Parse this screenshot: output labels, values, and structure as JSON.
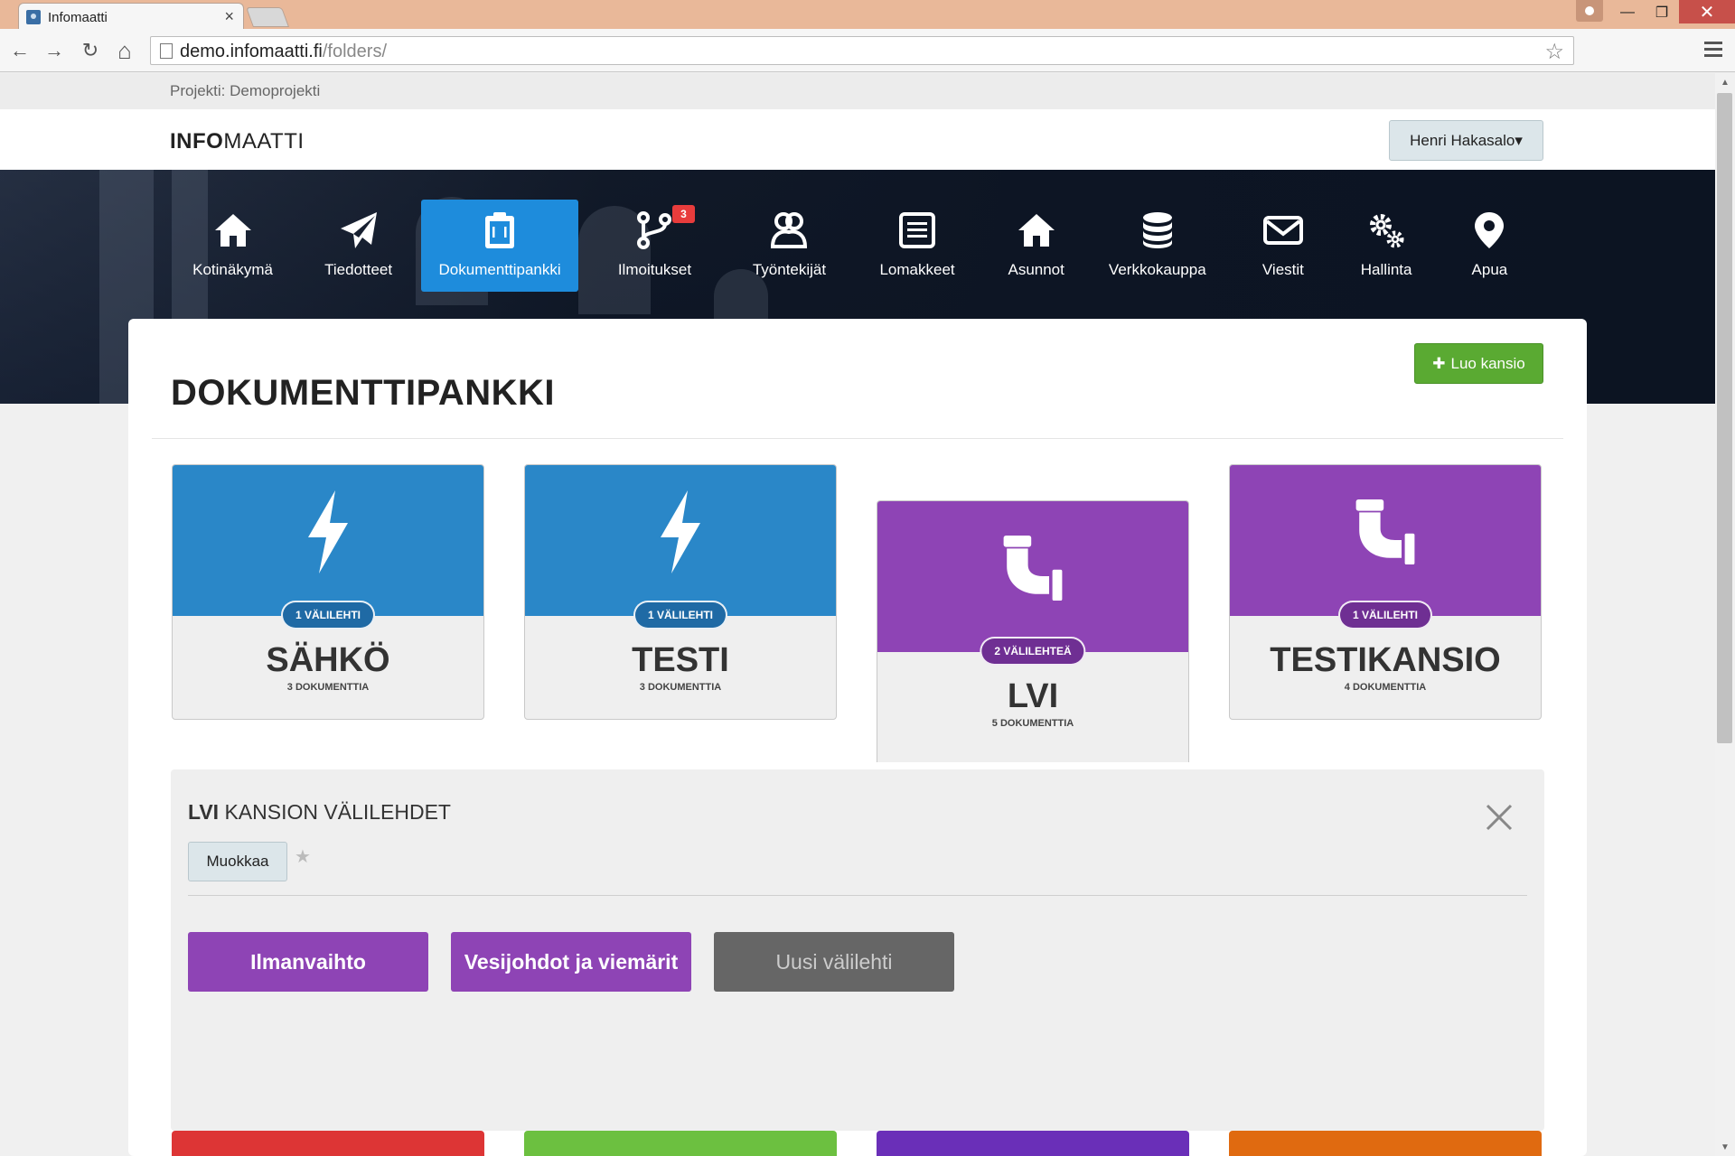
{
  "browser": {
    "tab_title": "Infomaatti",
    "tab_close": "×",
    "url_host": "demo.infomaatti.fi",
    "url_path": "/folders/",
    "back": "←",
    "forward": "→",
    "reload": "↻",
    "home": "⌂",
    "bookmark_star": "☆",
    "window_minimize": "—",
    "window_maximize": "❐",
    "window_close": "✕"
  },
  "scrollbar": {
    "up": "▲",
    "down": "▼"
  },
  "project_bar": {
    "label": "Projekti: Demoprojekti"
  },
  "header": {
    "logo_bold": "INFO",
    "logo_rest": "MAATTI",
    "user_menu": "Henri Hakasalo▾"
  },
  "navbar": {
    "items": [
      {
        "label": "Kotinäkymä",
        "icon": "home-icon"
      },
      {
        "label": "Tiedotteet",
        "icon": "paper-plane-icon"
      },
      {
        "label": "Dokumenttipankki",
        "icon": "clipboard-icon",
        "active": true
      },
      {
        "label": "Ilmoitukset",
        "icon": "branch-icon",
        "badge": "3"
      },
      {
        "label": "Työntekijät",
        "icon": "users-icon"
      },
      {
        "label": "Lomakkeet",
        "icon": "list-icon"
      },
      {
        "label": "Asunnot",
        "icon": "home-icon"
      },
      {
        "label": "Verkkokauppa",
        "icon": "database-icon"
      },
      {
        "label": "Viestit",
        "icon": "envelope-icon"
      },
      {
        "label": "Hallinta",
        "icon": "gears-icon"
      },
      {
        "label": "Apua",
        "icon": "map-marker-icon"
      }
    ]
  },
  "main": {
    "title": "DOKUMENTTIPANKKI",
    "create_folder": "Luo kansio",
    "create_icon": "✚"
  },
  "folders": [
    {
      "name": "SÄHKÖ",
      "tabs_badge": "1 VÄLILEHTI",
      "documents": "3 DOKUMENTTIA",
      "color": "#2a87c8",
      "badge_color": "#1f6aa5",
      "icon": "bolt-icon"
    },
    {
      "name": "TESTI",
      "tabs_badge": "1 VÄLILEHTI",
      "documents": "3 DOKUMENTTIA",
      "color": "#2a87c8",
      "badge_color": "#1f6aa5",
      "icon": "bolt-icon"
    },
    {
      "name": "LVI",
      "tabs_badge": "2 VÄLILEHTEÄ",
      "documents": "5 DOKUMENTTIA",
      "color": "#8e44b5",
      "badge_color": "#6f2f93",
      "icon": "pipe-icon",
      "selected": true
    },
    {
      "name": "TESTIKANSIO",
      "tabs_badge": "1 VÄLILEHTI",
      "documents": "4 DOKUMENTTIA",
      "color": "#8e44b5",
      "badge_color": "#6f2f93",
      "icon": "pipe-icon"
    }
  ],
  "folder_tabs_panel": {
    "title_bold": "LVI",
    "title_rest": " KANSION VÄLILEHDET",
    "edit": "Muokkaa",
    "star": "★",
    "tabs": [
      {
        "label": "Ilmanvaihto",
        "color": "#8e44b5"
      },
      {
        "label": "Vesijohdot ja viemärit",
        "color": "#8e44b5"
      },
      {
        "label": "Uusi välilehti",
        "color": "#666666",
        "text_color": "#cccccc"
      }
    ]
  },
  "bottom_folder_colors": [
    "#dd3535",
    "#6cc040",
    "#6a2fb8",
    "#e06a10"
  ]
}
